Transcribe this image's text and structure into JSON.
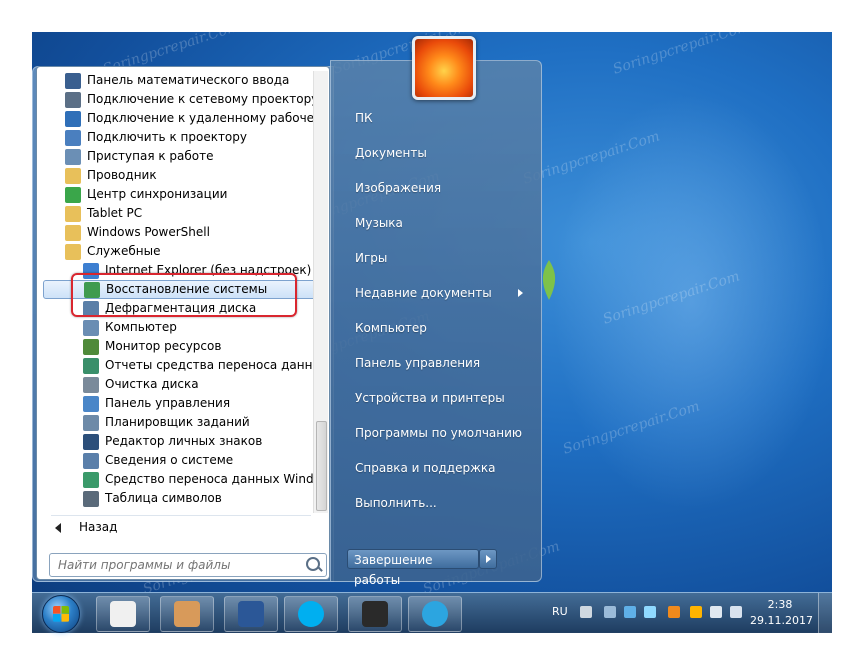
{
  "start_menu": {
    "programs": [
      {
        "label": "Панель математического ввода",
        "icon": "math-input-icon",
        "color": "#3a5f8f",
        "sub": false
      },
      {
        "label": "Подключение к сетевому проектору",
        "icon": "network-projector-icon",
        "color": "#5b6f86",
        "sub": false
      },
      {
        "label": "Подключение к удаленному рабочему столу",
        "icon": "remote-desktop-icon",
        "color": "#2f6fb8",
        "sub": false
      },
      {
        "label": "Подключить к проектору",
        "icon": "projector-icon",
        "color": "#4a7fbf",
        "sub": false
      },
      {
        "label": "Приступая к работе",
        "icon": "getting-started-icon",
        "color": "#6b8fb5",
        "sub": false
      },
      {
        "label": "Проводник",
        "icon": "explorer-folder-icon",
        "color": "#e8c05a",
        "sub": false
      },
      {
        "label": "Центр синхронизации",
        "icon": "sync-center-icon",
        "color": "#3aa64a",
        "sub": false
      },
      {
        "label": "Tablet PC",
        "icon": "folder-icon",
        "color": "#e8c05a",
        "sub": false
      },
      {
        "label": "Windows PowerShell",
        "icon": "folder-icon",
        "color": "#e8c05a",
        "sub": false
      },
      {
        "label": "Служебные",
        "icon": "folder-icon",
        "color": "#e8c05a",
        "sub": false
      },
      {
        "label": "Internet Explorer (без надстроек)",
        "icon": "internet-explorer-icon",
        "color": "#3d7fd1",
        "sub": true
      },
      {
        "label": "Восстановление системы",
        "icon": "system-restore-icon",
        "color": "#3f9b4f",
        "sub": true,
        "highlighted": true
      },
      {
        "label": "Дефрагментация диска",
        "icon": "disk-defrag-icon",
        "color": "#5a7fa8",
        "sub": true
      },
      {
        "label": "Компьютер",
        "icon": "computer-icon",
        "color": "#6a8db3",
        "sub": true
      },
      {
        "label": "Монитор ресурсов",
        "icon": "resource-monitor-icon",
        "color": "#4f8a3a",
        "sub": true
      },
      {
        "label": "Отчеты средства переноса данных Windows",
        "icon": "transfer-reports-icon",
        "color": "#3a8f6a",
        "sub": true
      },
      {
        "label": "Очистка диска",
        "icon": "disk-cleanup-icon",
        "color": "#7a8a9a",
        "sub": true
      },
      {
        "label": "Панель управления",
        "icon": "control-panel-icon",
        "color": "#4a86c8",
        "sub": true
      },
      {
        "label": "Планировщик заданий",
        "icon": "task-scheduler-icon",
        "color": "#6d8aa8",
        "sub": true
      },
      {
        "label": "Редактор личных знаков",
        "icon": "char-editor-icon",
        "color": "#2c4f7a",
        "sub": true
      },
      {
        "label": "Сведения о системе",
        "icon": "system-info-icon",
        "color": "#5a7faa",
        "sub": true
      },
      {
        "label": "Средство переноса данных Windows",
        "icon": "easy-transfer-icon",
        "color": "#3a9a6a",
        "sub": true
      },
      {
        "label": "Таблица символов",
        "icon": "char-map-icon",
        "color": "#5a6a7a",
        "sub": true
      }
    ],
    "back_label": "Назад",
    "search_placeholder": "Найти программы и файлы",
    "right_items": [
      {
        "label": "ПК",
        "submenu": false
      },
      {
        "label": "Документы",
        "submenu": false
      },
      {
        "label": "Изображения",
        "submenu": false
      },
      {
        "label": "Музыка",
        "submenu": false
      },
      {
        "label": "Игры",
        "submenu": false
      },
      {
        "label": "Недавние документы",
        "submenu": true
      },
      {
        "label": "Компьютер",
        "submenu": false
      },
      {
        "label": "Панель управления",
        "submenu": false
      },
      {
        "label": "Устройства и принтеры",
        "submenu": false
      },
      {
        "label": "Программы по умолчанию",
        "submenu": false
      },
      {
        "label": "Справка и поддержка",
        "submenu": false
      },
      {
        "label": "Выполнить...",
        "submenu": false
      }
    ],
    "shutdown_label": "Завершение работы"
  },
  "taskbar": {
    "buttons": [
      {
        "name": "panda-app-button",
        "icon": "panda-icon",
        "color": "#f0f0f0"
      },
      {
        "name": "handshake-app-button",
        "icon": "handshake-icon",
        "color": "#d89a5a"
      },
      {
        "name": "word-button",
        "icon": "word-icon",
        "color": "#2b5797"
      },
      {
        "name": "skype-button",
        "icon": "skype-icon",
        "color": "#00aff0"
      },
      {
        "name": "terminal-button",
        "icon": "terminal-icon",
        "color": "#2a2a2a"
      },
      {
        "name": "telegram-button",
        "icon": "telegram-icon",
        "color": "#2ca5e0"
      }
    ],
    "language": "RU",
    "time": "2:38",
    "date": "29.11.2017"
  },
  "watermark_text": "Soringpcrepair.Com"
}
